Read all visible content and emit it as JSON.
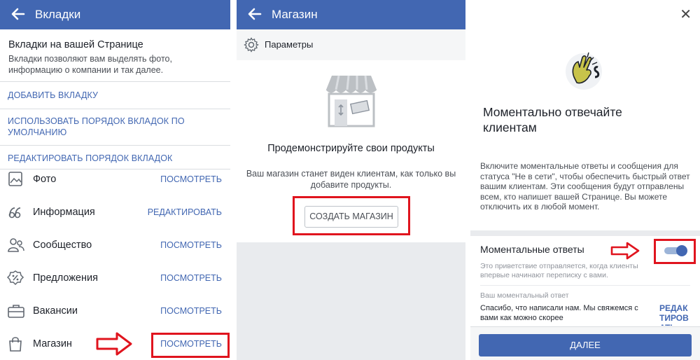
{
  "panel_tabs": {
    "header_title": "Вкладки",
    "section_title": "Вкладки на вашей Странице",
    "section_desc": "Вкладки позволяют вам выделять фото, информацию о компании и так далее.",
    "add_tab": "ДОБАВИТЬ ВКЛАДКУ",
    "use_order": "ИСПОЛЬЗОВАТЬ ПОРЯДОК ВКЛАДОК ПО УМОЛЧАНИЮ",
    "edit_order": "РЕДАКТИРОВАТЬ ПОРЯДОК ВКЛАДОК",
    "items": [
      {
        "label": "Фото",
        "action": "ПОСМОТРЕТЬ",
        "icon": "photo-icon"
      },
      {
        "label": "Информация",
        "action": "РЕДАКТИРОВАТЬ",
        "icon": "info-icon"
      },
      {
        "label": "Сообщество",
        "action": "ПОСМОТРЕТЬ",
        "icon": "community-icon"
      },
      {
        "label": "Предложения",
        "action": "ПОСМОТРЕТЬ",
        "icon": "offers-icon"
      },
      {
        "label": "Вакансии",
        "action": "ПОСМОТРЕТЬ",
        "icon": "jobs-icon"
      },
      {
        "label": "Магазин",
        "action": "ПОСМОТРЕТЬ",
        "icon": "shop-bag-icon"
      }
    ]
  },
  "panel_shop": {
    "header_title": "Магазин",
    "params_label": "Параметры",
    "promo_title": "Продемонстрируйте свои продукты",
    "promo_desc": "Ваш магазин станет виден клиентам, как только вы добавите продукты.",
    "create_button": "СОЗДАТЬ МАГАЗИН"
  },
  "panel_instant": {
    "title": "Моментально отвечайте клиентам",
    "desc": "Включите моментальные ответы и сообщения для статуса \"Не в сети\", чтобы обеспечить быстрый ответ вашим клиентам. Эти сообщения будут отправлены всем, кто напишет вашей Странице. Вы можете отключить их в любой момент.",
    "toggle_label": "Моментальные ответы",
    "toggle_on": true,
    "toggle_hint": "Это приветствие отправляется, когда клиенты впервые начинают переписку с вами.",
    "your_reply_label": "Ваш моментальный ответ",
    "reply_text": "Спасибо, что написали нам. Мы свяжемся с вами как можно скорее",
    "edit_label": "РЕДАКТИРОВАТЬ",
    "next_button": "ДАЛЕЕ"
  },
  "colors": {
    "header_blue": "#4267b2",
    "link_blue": "#4267b2",
    "highlight_red": "#e0141e",
    "toggle_blue": "#4267b2"
  }
}
